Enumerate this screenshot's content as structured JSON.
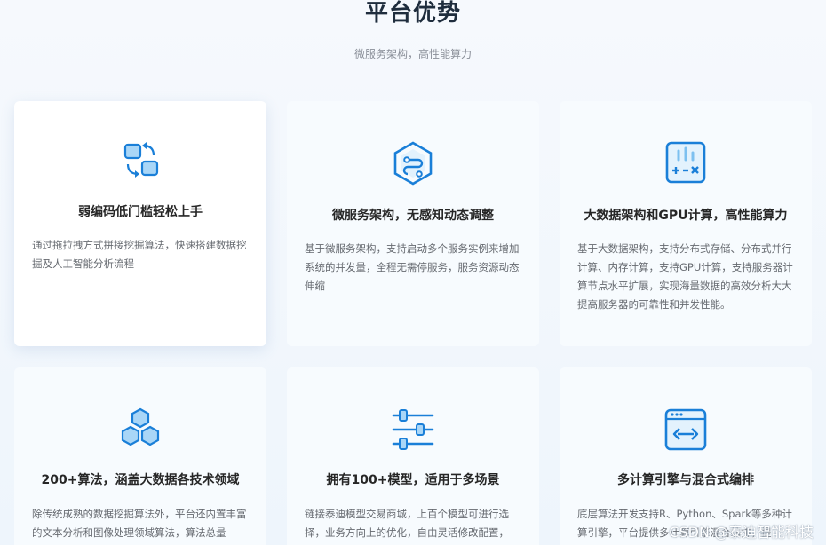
{
  "header": {
    "title": "平台优势",
    "subtitle": "微服务架构，高性能算力"
  },
  "cards": [
    {
      "icon": "swap-arrows-icon",
      "title": "弱编码低门槛轻松上手",
      "desc": "通过拖拉拽方式拼接挖掘算法，快速搭建数据挖掘及人工智能分析流程"
    },
    {
      "icon": "hexagon-flow-icon",
      "title": "微服务架构，无感知动态调整",
      "desc": "基于微服务架构，支持启动多个服务实例来增加系统的并发量，全程无需停服务，服务资源动态伸缩"
    },
    {
      "icon": "calculator-chart-icon",
      "title": "大数据架构和GPU计算，高性能算力",
      "desc": "基于大数据架构，支持分布式存储、分布式并行计算、内存计算，支持GPU计算，支持服务器计算节点水平扩展，实现海量数据的高效分析大大提高服务器的可靠性和并发性能。"
    },
    {
      "icon": "cubes-icon",
      "title": "200+算法，涵盖大数据各技术领域",
      "desc": "除传统成熟的数据挖掘算法外，平台还内置丰富的文本分析和图像处理领域算法，算法总量"
    },
    {
      "icon": "sliders-icon",
      "title": "拥有100+模型，适用于多场景",
      "desc": "链接泰迪模型交易商城，上百个模型可进行选择，业务方向上的优化，自由灵活修改配置，"
    },
    {
      "icon": "code-window-icon",
      "title": "多计算引擎与混合式编排",
      "desc": "底层算法开发支持R、Python、Spark等多种计算引擎，平台提供多计算引擎混合编排，提"
    }
  ],
  "watermark": "CSDN @泰迪智能科技",
  "colors": {
    "accent": "#1a7fd8",
    "accent_light": "#7cc0f0"
  }
}
